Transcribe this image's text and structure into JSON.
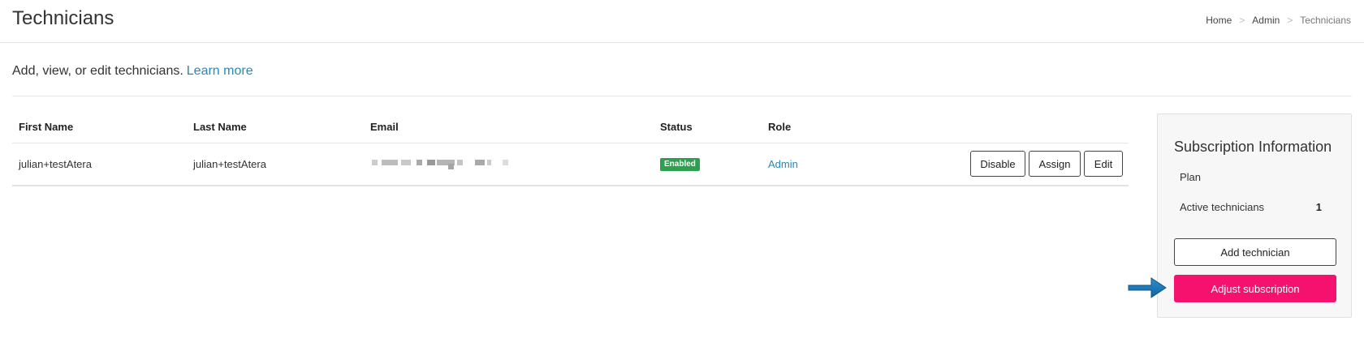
{
  "header": {
    "title": "Technicians",
    "breadcrumb": [
      {
        "label": "Home",
        "link": true
      },
      {
        "label": "Admin",
        "link": true
      },
      {
        "label": "Technicians",
        "link": false
      }
    ],
    "separator": ">"
  },
  "intro": {
    "text": "Add, view, or edit technicians.",
    "link_label": "Learn more"
  },
  "table": {
    "columns": [
      "First Name",
      "Last Name",
      "Email",
      "Status",
      "Role"
    ],
    "rows": [
      {
        "first_name": "julian+testAtera",
        "last_name": "julian+testAtera",
        "email": "",
        "status": "Enabled",
        "role": "Admin",
        "actions": [
          "Disable",
          "Assign",
          "Edit"
        ]
      }
    ]
  },
  "subscription": {
    "title": "Subscription Information",
    "plan_label": "Plan",
    "plan_value": "",
    "active_label": "Active technicians",
    "active_value": "1",
    "add_button": "Add technician",
    "adjust_button": "Adjust subscription"
  },
  "colors": {
    "accent_link": "#2a88b2",
    "status_enabled": "#2e9e4f",
    "primary_pink": "#f5116e",
    "arrow_blue": "#1f7ab8"
  },
  "icons": {
    "pointer_arrow": "arrow-right-icon"
  }
}
